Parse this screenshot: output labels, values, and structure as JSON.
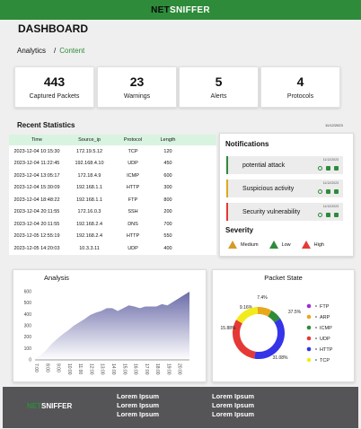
{
  "header": {
    "brand_part1": "NET",
    "brand_part2": "SNIFFER"
  },
  "page_title": "DASHBOARD",
  "breadcrumb": {
    "first": "Analytics",
    "separator": "/",
    "current": "Content"
  },
  "stats": [
    {
      "value": "443",
      "label": "Captured Packets"
    },
    {
      "value": "23",
      "label": "Warnings"
    },
    {
      "value": "5",
      "label": "Alerts"
    },
    {
      "value": "4",
      "label": "Protocols"
    }
  ],
  "recent": {
    "title": "Recent Statistics",
    "date": "11/12/2023",
    "columns": [
      "Time",
      "Source_ip",
      "Protocol",
      "Length"
    ],
    "rows": [
      [
        "2023-12-04 10:15:30",
        "172.19.5.12",
        "TCP",
        "120"
      ],
      [
        "2023-12-04 11:22:45",
        "192.168.4.10",
        "UDP",
        "450"
      ],
      [
        "2023-12-04 13:05:17",
        "172.18.4.9",
        "ICMP",
        "600"
      ],
      [
        "2023-12-04 15:30:09",
        "192.168.1.1",
        "HTTP",
        "300"
      ],
      [
        "2023-12-04 18:48:22",
        "192.168.1.1",
        "FTP",
        "800"
      ],
      [
        "2023-12-04 20:11:55",
        "172.16.0.3",
        "SSH",
        "200"
      ],
      [
        "2023-12-04 20:11:55",
        "192.168.2.4",
        "DNS",
        "700"
      ],
      [
        "2023-12-05 12:55:19",
        "192.168.2.4",
        "HTTP",
        "550"
      ],
      [
        "2023-12-05 14:20:03",
        "10.3.3.11",
        "UDP",
        "400"
      ]
    ]
  },
  "notifications": {
    "title": "Notifications",
    "items": [
      {
        "text": "potential attack",
        "date": "11/12/2023",
        "color": "#2e8b3a"
      },
      {
        "text": "Suspicious activity",
        "date": "11/12/2023",
        "color": "#e0a81f"
      },
      {
        "text": "Security vulnerability",
        "date": "11/12/2023",
        "color": "#e53935"
      }
    ]
  },
  "severity": {
    "title": "Severity",
    "levels": [
      {
        "label": "Medium",
        "color": "#d69a2a"
      },
      {
        "label": "Low",
        "color": "#2e8b3a"
      },
      {
        "label": "High",
        "color": "#e53935"
      }
    ]
  },
  "analysis": {
    "title": "Analysis",
    "chart_data": {
      "type": "area",
      "title": "Analysis",
      "ylim": [
        0,
        600
      ],
      "yticks": [
        "0",
        "100",
        "200",
        "300",
        "400",
        "500",
        "600"
      ],
      "xticks": [
        "7:00",
        "8:00",
        "9:00",
        "10:00",
        "11:00",
        "12:00",
        "13:00",
        "14:00",
        "15:00",
        "16:00",
        "17:00",
        "18:00",
        "19:00",
        "20:00"
      ],
      "x": [
        0,
        0.5,
        1,
        1.5,
        2,
        2.5,
        3,
        3.5,
        4,
        4.5,
        5,
        5.5,
        6,
        6.5,
        7,
        7.5,
        8,
        8.5,
        9,
        9.5,
        10,
        10.5,
        11,
        11.5,
        12,
        12.5,
        13,
        13.5,
        14
      ],
      "values": [
        10,
        40,
        85,
        140,
        185,
        225,
        260,
        300,
        330,
        360,
        395,
        415,
        430,
        455,
        455,
        430,
        455,
        480,
        470,
        455,
        470,
        470,
        470,
        490,
        480,
        510,
        540,
        570,
        600
      ],
      "color": "#6b6ba9"
    }
  },
  "packet_state": {
    "title": "Packet State",
    "chart_data": {
      "type": "pie",
      "title": "Packet State",
      "labels": [
        "FTP",
        "ARP",
        "ICMP",
        "UDP",
        "HTTP",
        "TCP"
      ],
      "values": [
        9.16,
        7.4,
        37.5,
        31.08,
        15.88,
        0
      ],
      "percent_labels": [
        "9.16%",
        "7.4%",
        "37.5%",
        "31.08%",
        "15.88%"
      ],
      "colors": [
        "#9b2fd6",
        "#e9a81c",
        "#2e8b3a",
        "#e53935",
        "#3434e8",
        "#f3ea1a"
      ],
      "ring_colors": [
        "#e9a81c",
        "#2e8b3a",
        "#3434e8",
        "#e53935",
        "#f3ea1a"
      ]
    }
  },
  "footer": {
    "brand_part1": "NET",
    "brand_part2": "SNIFFER",
    "col1": [
      "Lorem Ipsum",
      "Lorem Ipsum",
      "Lorem Ipsum"
    ],
    "col2": [
      "Lorem Ipsum",
      "Lorem Ipsum",
      "Lorem Ipsum"
    ]
  }
}
